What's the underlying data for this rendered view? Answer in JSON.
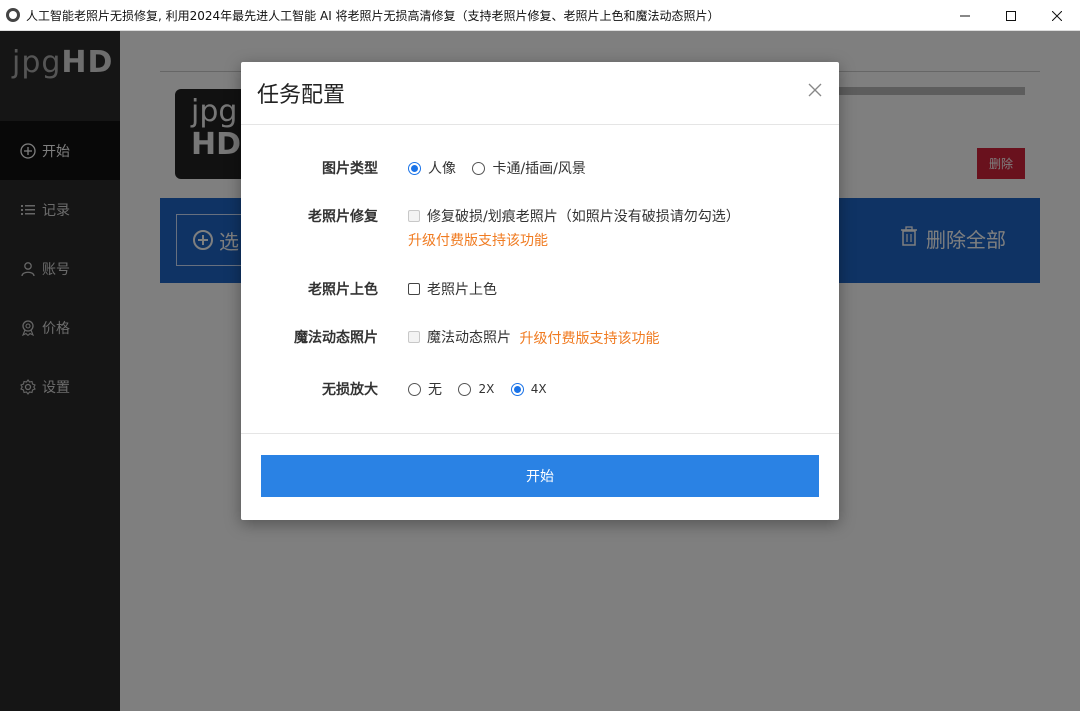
{
  "window": {
    "title": "人工智能老照片无损修复, 利用2024年最先进人工智能 AI 将老照片无损高清修复（支持老照片修复、老照片上色和魔法动态照片）"
  },
  "sidebar": {
    "brand_light": "jpg",
    "brand_bold": "HD",
    "items": [
      {
        "label": "开始",
        "icon": "plus-circle-icon",
        "active": true
      },
      {
        "label": "记录",
        "icon": "list-icon",
        "active": false
      },
      {
        "label": "账号",
        "icon": "user-icon",
        "active": false
      },
      {
        "label": "价格",
        "icon": "badge-icon",
        "active": false
      },
      {
        "label": "设置",
        "icon": "gear-icon",
        "active": false
      }
    ]
  },
  "background": {
    "logo_light": "jpg",
    "logo_bold": "HD",
    "delete_label": "删除",
    "select_label": "选",
    "delete_all_label": "删除全部"
  },
  "modal": {
    "title": "任务配置",
    "rows": {
      "image_type": {
        "label": "图片类型",
        "options": [
          "人像",
          "卡通/插画/风景"
        ],
        "selected": "人像"
      },
      "restore": {
        "label": "老照片修复",
        "checkbox_label": "修复破损/划痕老照片（如照片没有破损请勿勾选）",
        "upgrade_note": "升级付费版支持该功能"
      },
      "colorize": {
        "label": "老照片上色",
        "checkbox_label": "老照片上色"
      },
      "animate": {
        "label": "魔法动态照片",
        "checkbox_label": "魔法动态照片",
        "upgrade_note": "升级付费版支持该功能"
      },
      "upscale": {
        "label": "无损放大",
        "options": [
          "无",
          "2X",
          "4X"
        ],
        "selected": "4X"
      }
    },
    "start_label": "开始"
  },
  "colors": {
    "accent": "#2a82e4",
    "upgrade": "#f07b21",
    "danger": "#d3233a",
    "sidebar": "#2b2b2b"
  }
}
